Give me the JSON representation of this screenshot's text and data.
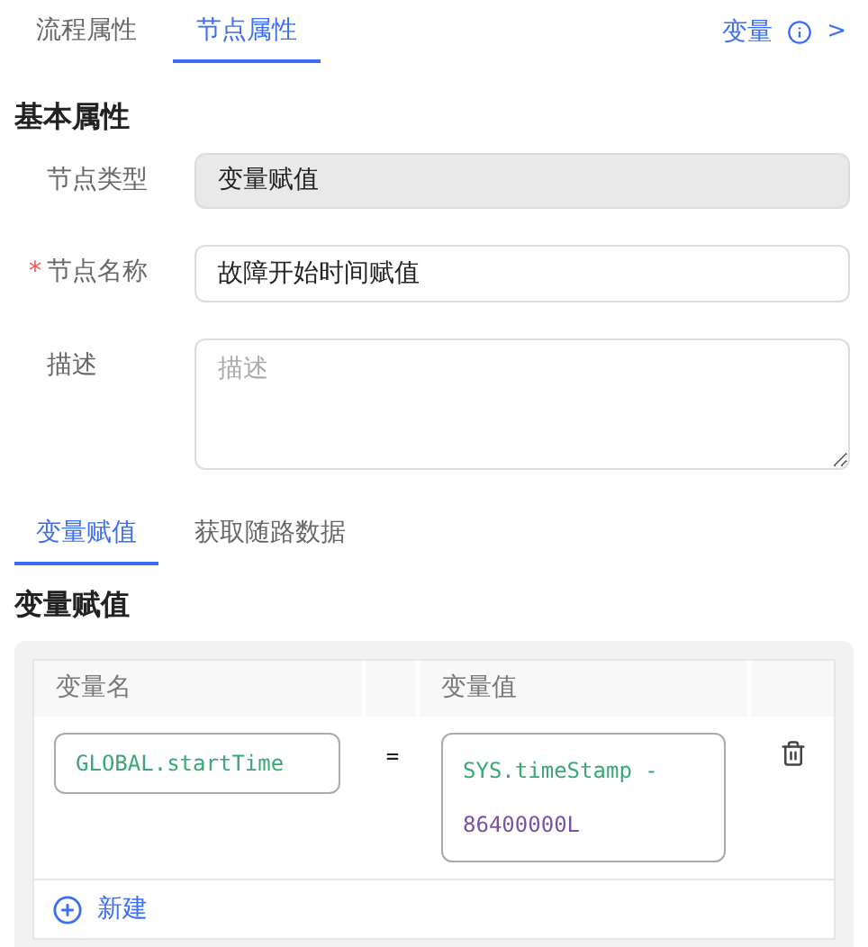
{
  "tabs": [
    {
      "label": "流程属性",
      "selected": false
    },
    {
      "label": "节点属性",
      "selected": true
    }
  ],
  "variables_link": {
    "label": "变量",
    "arrow": ">"
  },
  "basic_section": {
    "title": "基本属性",
    "fields": [
      {
        "kind": "readonly",
        "label": "节点类型",
        "value": "变量赋值"
      },
      {
        "kind": "input",
        "label": "节点名称",
        "required_mark": "*",
        "value": "故障开始时间赋值"
      },
      {
        "kind": "textarea",
        "label": "描述",
        "placeholder": "描述"
      }
    ]
  },
  "sub_tabs": [
    {
      "label": "变量赋值",
      "selected": true
    },
    {
      "label": "获取随路数据",
      "selected": false
    }
  ],
  "assign_section": {
    "title": "变量赋值",
    "table": {
      "columns": [
        "变量名",
        "变量值"
      ],
      "rows": [
        {
          "name": [
            {
              "kind": "identifier",
              "text": "GLOBAL.startTime"
            }
          ],
          "operator": "=",
          "value": [
            {
              "kind": "identifier",
              "text": "SYS.timeStamp -"
            },
            {
              "kind": "number",
              "text": "86400000L"
            }
          ]
        }
      ]
    },
    "add_button": "新建"
  }
}
